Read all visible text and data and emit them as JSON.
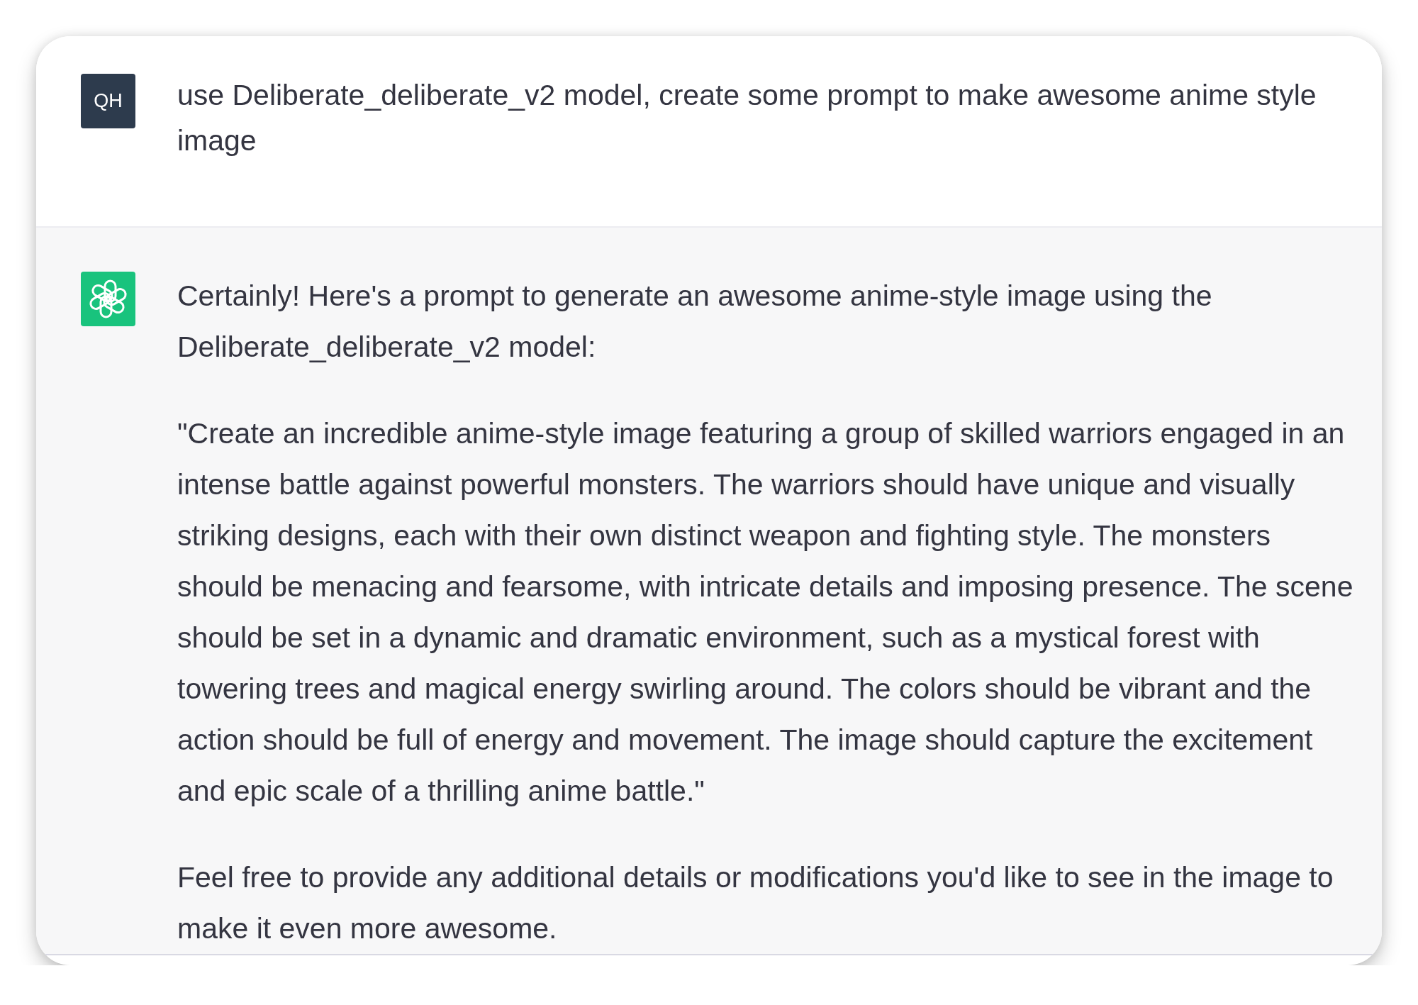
{
  "messages": [
    {
      "kind": "user",
      "avatar_initials": "QH",
      "paragraphs": [
        "use Deliberate_deliberate_v2 model, create some prompt to make awesome anime style image"
      ]
    },
    {
      "kind": "assistant",
      "paragraphs": [
        "Certainly! Here's a prompt to generate an awesome anime-style image using the Deliberate_deliberate_v2 model:",
        "\"Create an incredible anime-style image featuring a group of skilled warriors engaged in an intense battle against powerful monsters. The warriors should have unique and visually striking designs, each with their own distinct weapon and fighting style. The monsters should be menacing and fearsome, with intricate details and imposing presence. The scene should be set in a dynamic and dramatic environment, such as a mystical forest with towering trees and magical energy swirling around. The colors should be vibrant and the action should be full of energy and movement. The image should capture the excitement and epic scale of a thrilling anime battle.\"",
        "Feel free to provide any additional details or modifications you'd like to see in the image to make it even more awesome."
      ]
    }
  ]
}
